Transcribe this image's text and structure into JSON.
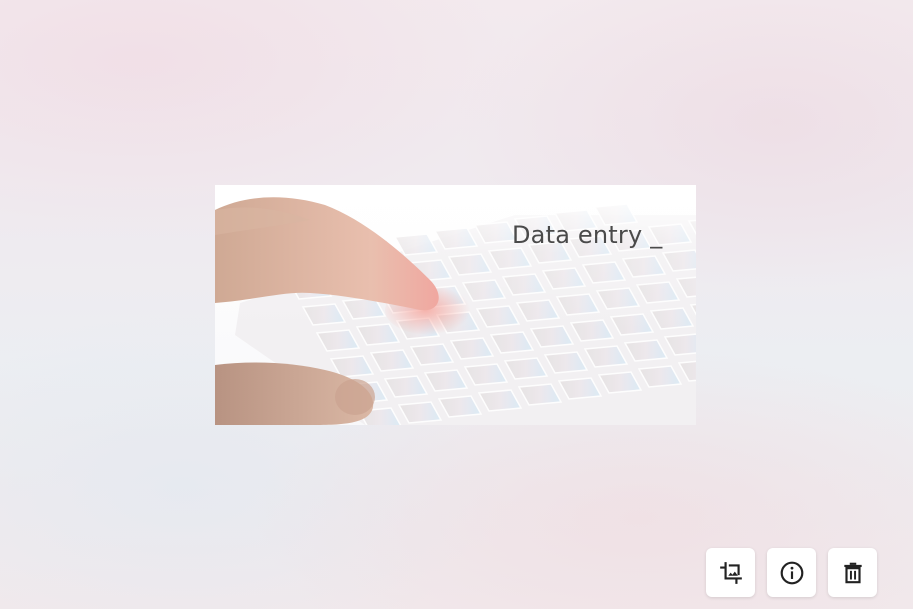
{
  "preview": {
    "caption": "Data entry _"
  },
  "toolbar": {
    "buttons": [
      {
        "id": "crop",
        "icon": "crop-icon"
      },
      {
        "id": "info",
        "icon": "info-icon"
      },
      {
        "id": "delete",
        "icon": "trash-icon"
      }
    ]
  },
  "colors": {
    "icon": "#222222",
    "caption": "#4a4a4a",
    "button_bg": "#ffffff"
  }
}
